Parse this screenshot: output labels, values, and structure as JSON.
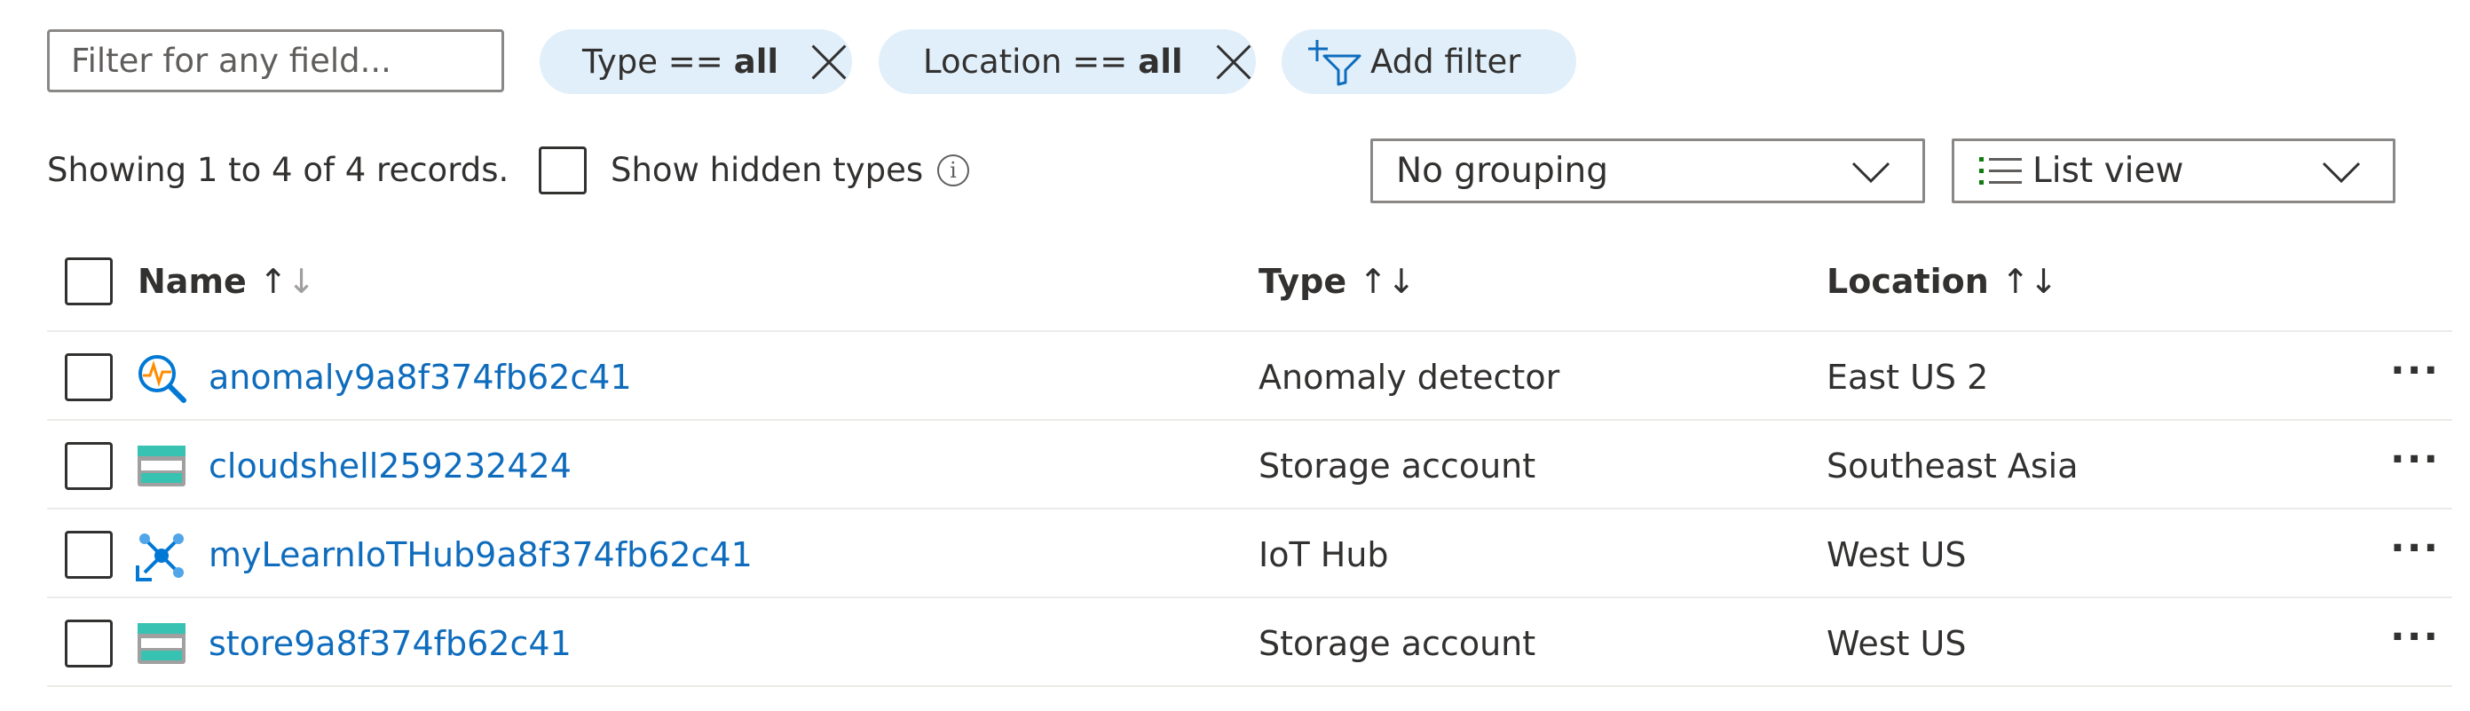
{
  "filter": {
    "placeholder": "Filter for any field..."
  },
  "pills": [
    {
      "label": "Type ==",
      "value": "all"
    },
    {
      "label": "Location ==",
      "value": "all"
    }
  ],
  "add_filter": {
    "label": "Add filter",
    "icon": "add-filter-icon"
  },
  "summary": {
    "records_text": "Showing 1 to 4 of 4 records.",
    "show_hidden_label": "Show hidden types"
  },
  "grouping": {
    "selected": "No grouping"
  },
  "view": {
    "selected": "List view",
    "icon": "list-icon"
  },
  "table": {
    "columns": [
      {
        "label": "Name"
      },
      {
        "label": "Type"
      },
      {
        "label": "Location"
      }
    ],
    "rows": [
      {
        "name": "anomaly9a8f374fb62c41",
        "type": "Anomaly detector",
        "location": "East US 2",
        "icon": "anomaly-detector-icon"
      },
      {
        "name": "cloudshell259232424",
        "type": "Storage account",
        "location": "Southeast Asia",
        "icon": "storage-account-icon"
      },
      {
        "name": "myLearnIoTHub9a8f374fb62c41",
        "type": "IoT Hub",
        "location": "West US",
        "icon": "iot-hub-icon"
      },
      {
        "name": "store9a8f374fb62c41",
        "type": "Storage account",
        "location": "West US",
        "icon": "storage-account-icon"
      }
    ]
  },
  "colors": {
    "accent": "#0f6cbd",
    "pill_bg": "#e1effa",
    "border": "#8a8886"
  }
}
